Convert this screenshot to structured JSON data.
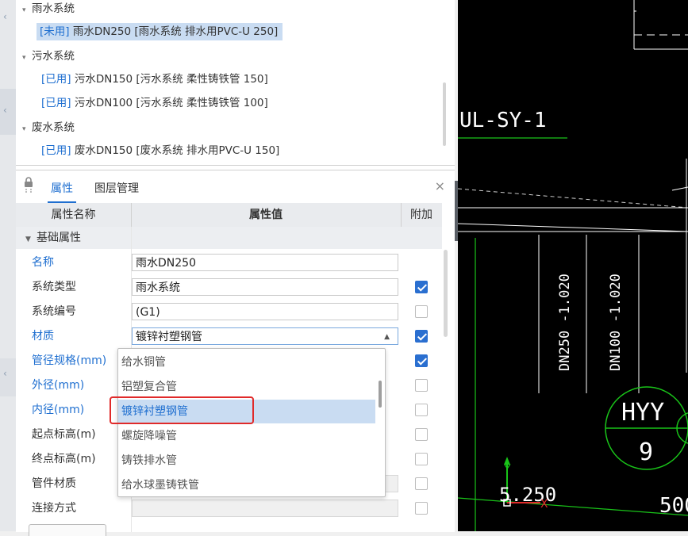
{
  "tree": {
    "groups": [
      {
        "label": "雨水系统",
        "items": [
          {
            "tag": "[未用]",
            "text": " 雨水DN250 [雨水系统 排水用PVC-U 250]",
            "selected": true
          }
        ]
      },
      {
        "label": "污水系统",
        "items": [
          {
            "tag": "[已用]",
            "text": " 污水DN150 [污水系统 柔性铸铁管 150]"
          },
          {
            "tag": "[已用]",
            "text": " 污水DN100 [污水系统 柔性铸铁管 100]"
          }
        ]
      },
      {
        "label": "废水系统",
        "items": [
          {
            "tag": "[已用]",
            "text": " 废水DN150 [废水系统 排水用PVC-U 150]"
          }
        ]
      }
    ]
  },
  "panel": {
    "tabs": [
      "属性",
      "图层管理"
    ],
    "close_icon": "close-icon",
    "lock_icon": "lock-icon",
    "columns": [
      "属性名称",
      "属性值",
      "附加"
    ],
    "section": "基础属性",
    "rows": [
      {
        "label": "名称",
        "value": "雨水DN250",
        "blue": true,
        "checkbox": "none"
      },
      {
        "label": "系统类型",
        "value": "雨水系统",
        "blue": false,
        "checkbox": "on"
      },
      {
        "label": "系统编号",
        "value": "(G1)",
        "blue": false,
        "checkbox": "off"
      },
      {
        "label": "材质",
        "value": "镀锌衬塑钢管",
        "blue": true,
        "checkbox": "on"
      },
      {
        "label": "管径规格(mm)",
        "value": "",
        "blue": true,
        "checkbox": "on"
      },
      {
        "label": "外径(mm)",
        "value": "",
        "blue": true,
        "checkbox": "off"
      },
      {
        "label": "内径(mm)",
        "value": "",
        "blue": true,
        "checkbox": "off"
      },
      {
        "label": "起点标高(m)",
        "value": "",
        "blue": false,
        "checkbox": "off"
      },
      {
        "label": "终点标高(m)",
        "value": "",
        "blue": false,
        "checkbox": "off"
      },
      {
        "label": "管件材质",
        "value": "",
        "blue": false,
        "checkbox": "off"
      },
      {
        "label": "连接方式",
        "value": "",
        "blue": false,
        "checkbox": "off"
      }
    ]
  },
  "dropdown": {
    "options": [
      "给水铜管",
      "铝塑复合管",
      "镀锌衬塑钢管",
      "螺旋降噪管",
      "铸铁排水管",
      "给水球墨铸铁管"
    ],
    "selected_index": 2
  },
  "cad": {
    "labels": [
      "UL-SY-1",
      "DN250 -1.020",
      "DN100 -1.020",
      "HYY",
      "9",
      "5.250",
      "500",
      "Y",
      "X"
    ]
  },
  "colors": {
    "accent": "#1f6fd0",
    "selection": "#c9dcf2",
    "highlight": "#e02a2a",
    "cad_green": "#19c419"
  }
}
